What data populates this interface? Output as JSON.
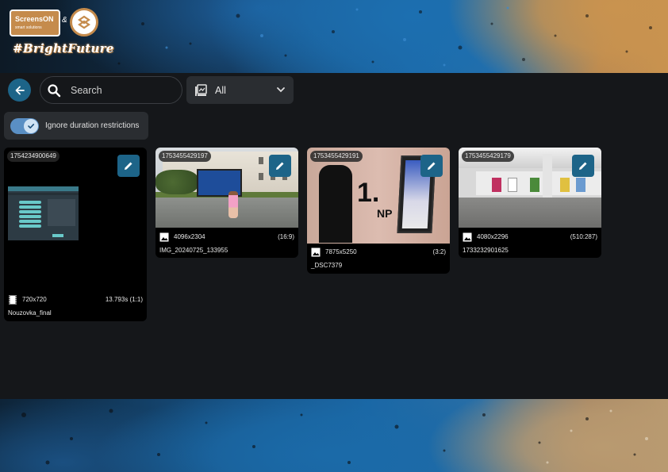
{
  "logo": {
    "brand": "ScreensON",
    "brand_sub": "smart solutions",
    "amp": "&",
    "tagline": "#BrightFuture"
  },
  "toolbar": {
    "search_placeholder": "Search",
    "filter_label": "All",
    "toggle_label": "Ignore duration restrictions",
    "toggle_checked": true
  },
  "colors": {
    "accent": "#1d6488",
    "toggle": "#5a8fc4",
    "surface": "#2a2d31",
    "background": "#15171a"
  },
  "cards": [
    {
      "id": "1754234900649",
      "media": "video",
      "dimensions": "720x720",
      "ratio": "13.793s  (1:1)",
      "filename": "Nouzovka_final"
    },
    {
      "id": "1753455429197",
      "media": "image",
      "dimensions": "4096x2304",
      "ratio": "(16:9)",
      "filename": "IMG_20240725_133955"
    },
    {
      "id": "1753455429191",
      "media": "image",
      "dimensions": "7875x5250",
      "ratio": "(3:2)",
      "filename": "_DSC7379"
    },
    {
      "id": "1753455429179",
      "media": "image",
      "dimensions": "4080x2296",
      "ratio": "(510:287)",
      "filename": "1733232901625"
    }
  ]
}
